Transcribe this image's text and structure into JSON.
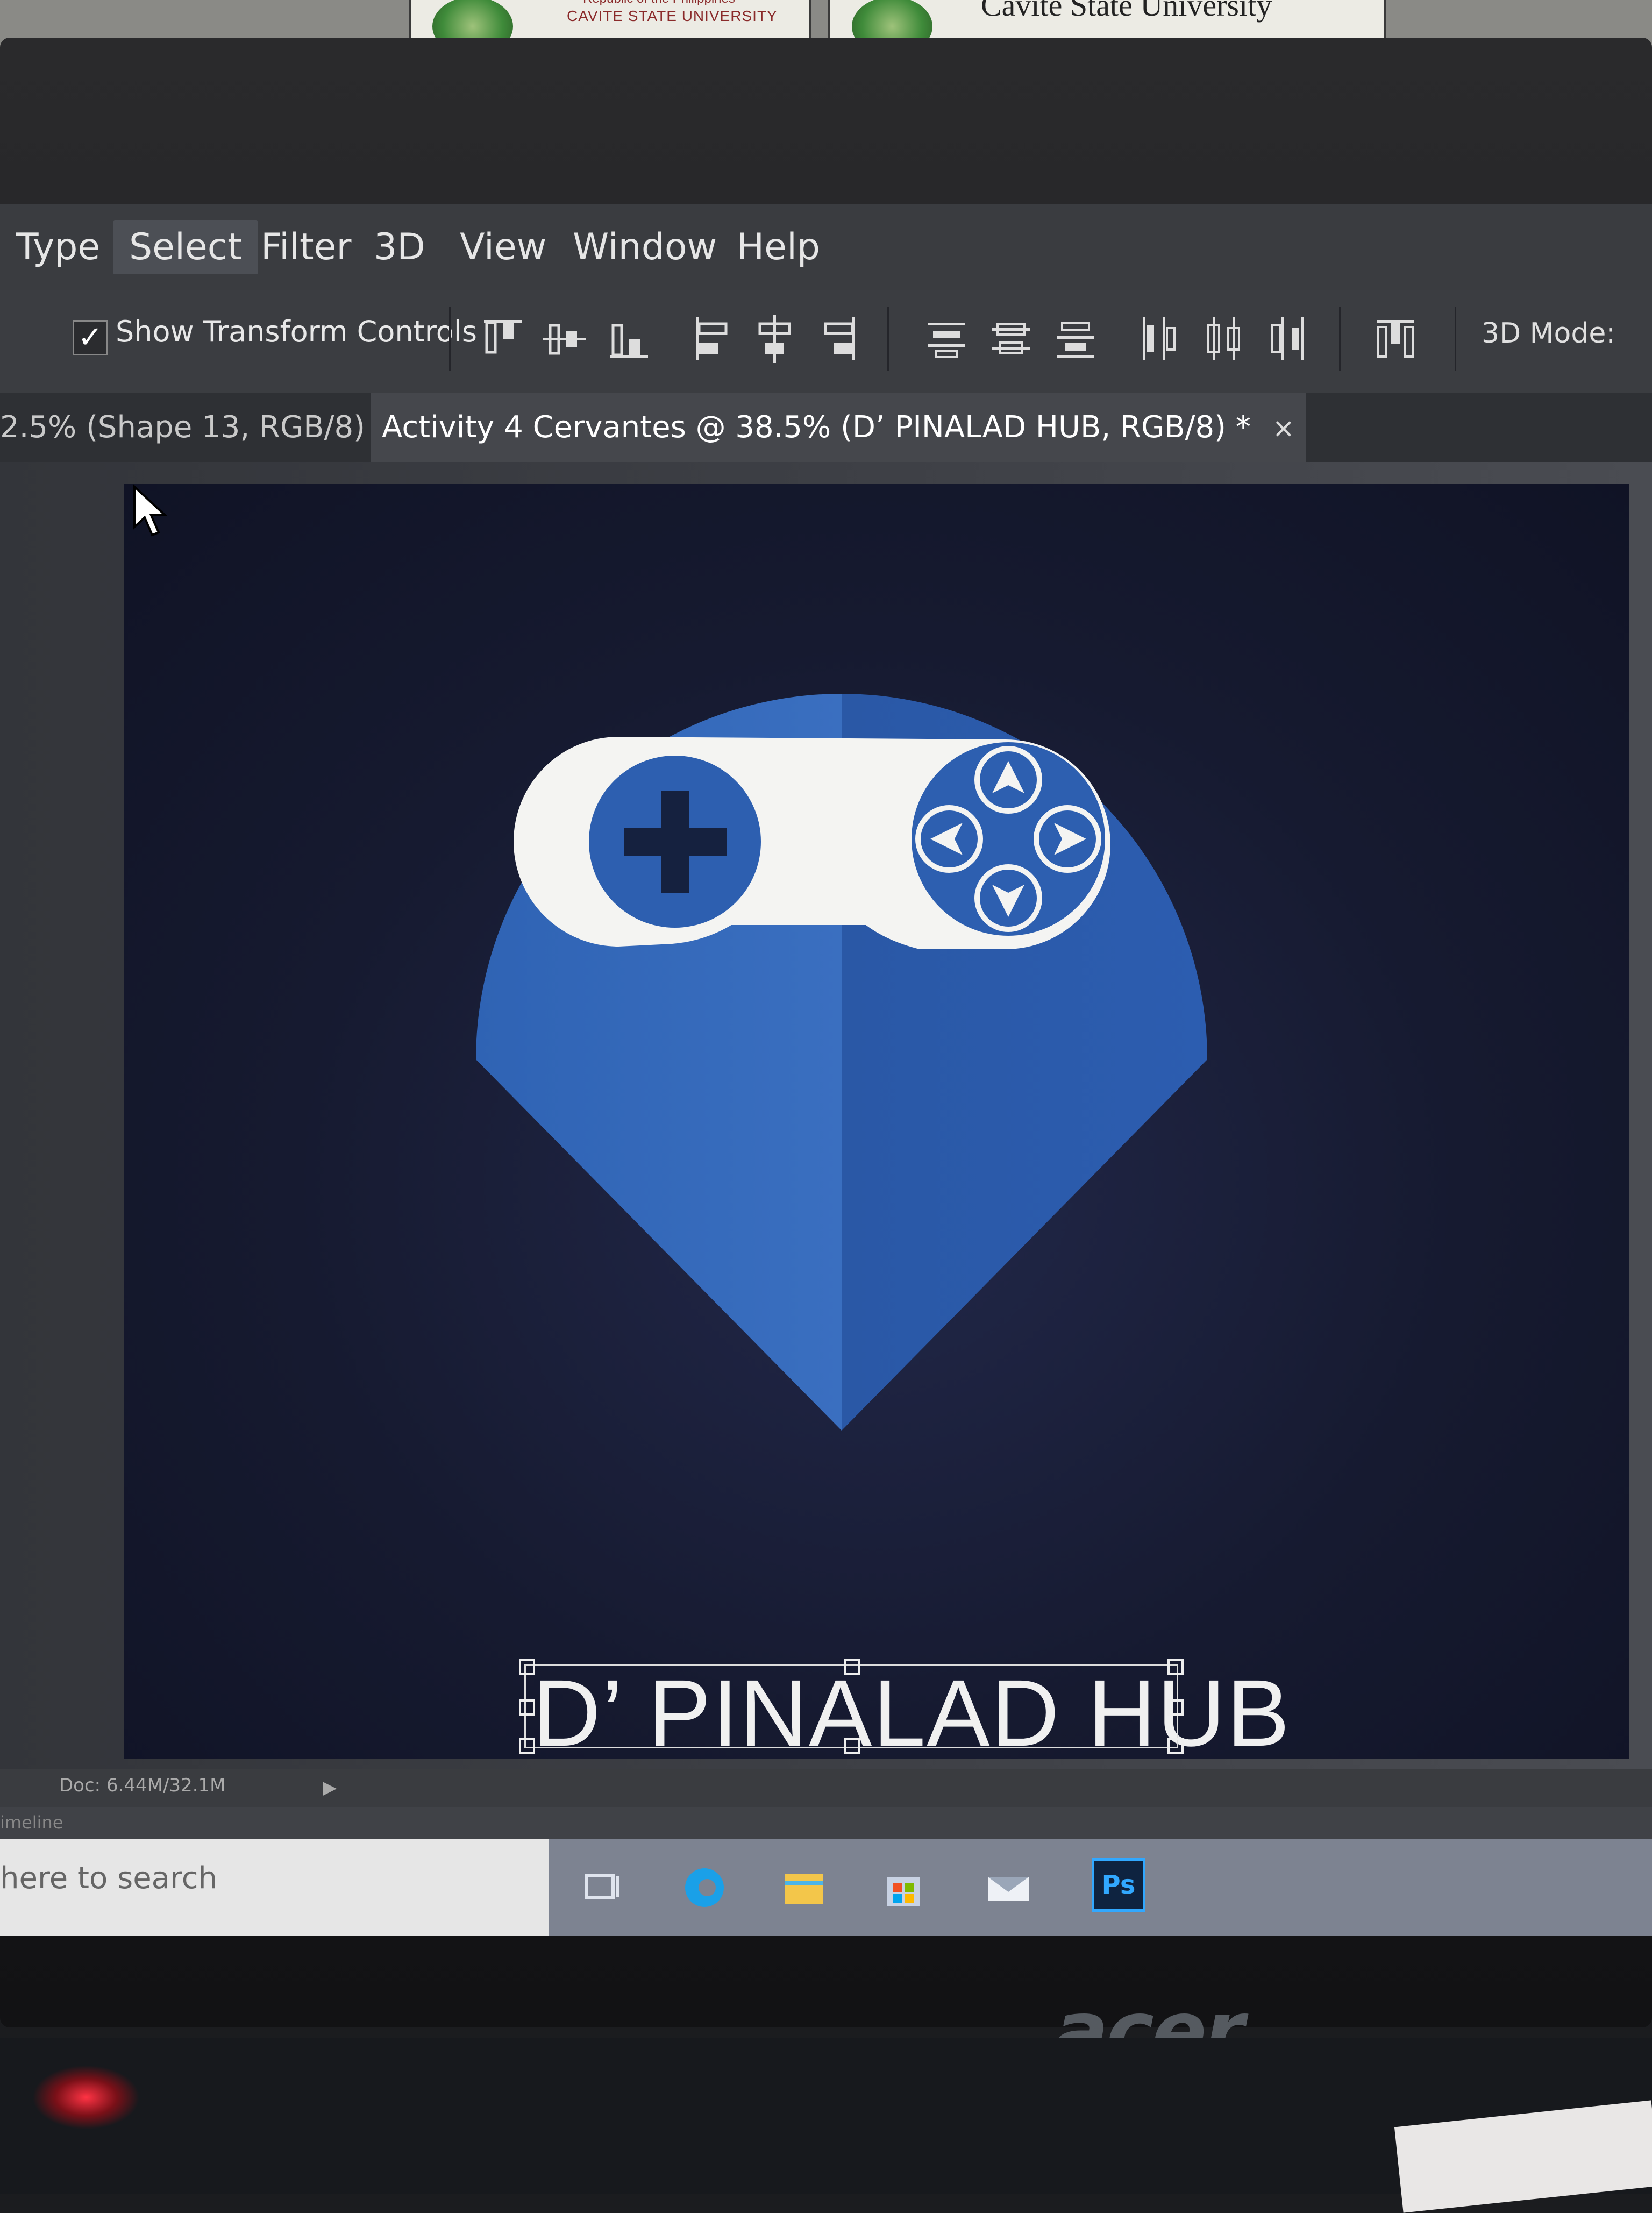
{
  "wall_signs": {
    "left_line1": "Republic of the Philippines",
    "left_line2": "CAVITE STATE UNIVERSITY",
    "right_title": "Cavite State University"
  },
  "menubar": {
    "items": [
      "Type",
      "Select",
      "Filter",
      "3D",
      "View",
      "Window",
      "Help"
    ],
    "active": "Select"
  },
  "options_bar": {
    "show_transform_controls_label": "Show Transform Controls",
    "show_transform_controls_checked": true,
    "mode_label": "3D Mode:",
    "align_icons": [
      "align-top-edges-icon",
      "align-vertical-centers-icon",
      "align-bottom-edges-icon",
      "align-left-edges-icon",
      "align-horizontal-centers-icon",
      "align-right-edges-icon",
      "distribute-top-icon",
      "distribute-vertical-centers-icon",
      "distribute-bottom-icon",
      "distribute-left-icon",
      "distribute-horizontal-centers-icon",
      "distribute-right-icon",
      "auto-align-icon"
    ]
  },
  "tabs": [
    {
      "label": "2.5% (Shape 13, RGB/8)",
      "close": "×",
      "active": false
    },
    {
      "label": "Activity 4 Cervantes @ 38.5% (D’ PINALAD HUB, RGB/8) *",
      "close": "×",
      "active": true
    }
  ],
  "canvas": {
    "logo_text": "D’ PINALAD HUB",
    "colors": {
      "pin": "#2f63b4",
      "controller": "#f4f4f2",
      "background": "#161a30"
    }
  },
  "status_bar": {
    "doc_info": "Doc: 6.44M/32.1M",
    "arrow": "▶"
  },
  "timeline": {
    "label": "imeline"
  },
  "taskbar": {
    "search_placeholder": "here to search",
    "icons": [
      "task-view-icon",
      "edge-icon",
      "file-explorer-icon",
      "store-icon",
      "mail-icon",
      "photoshop-icon"
    ],
    "ps_label": "Ps"
  },
  "monitor": {
    "brand": "acer"
  }
}
